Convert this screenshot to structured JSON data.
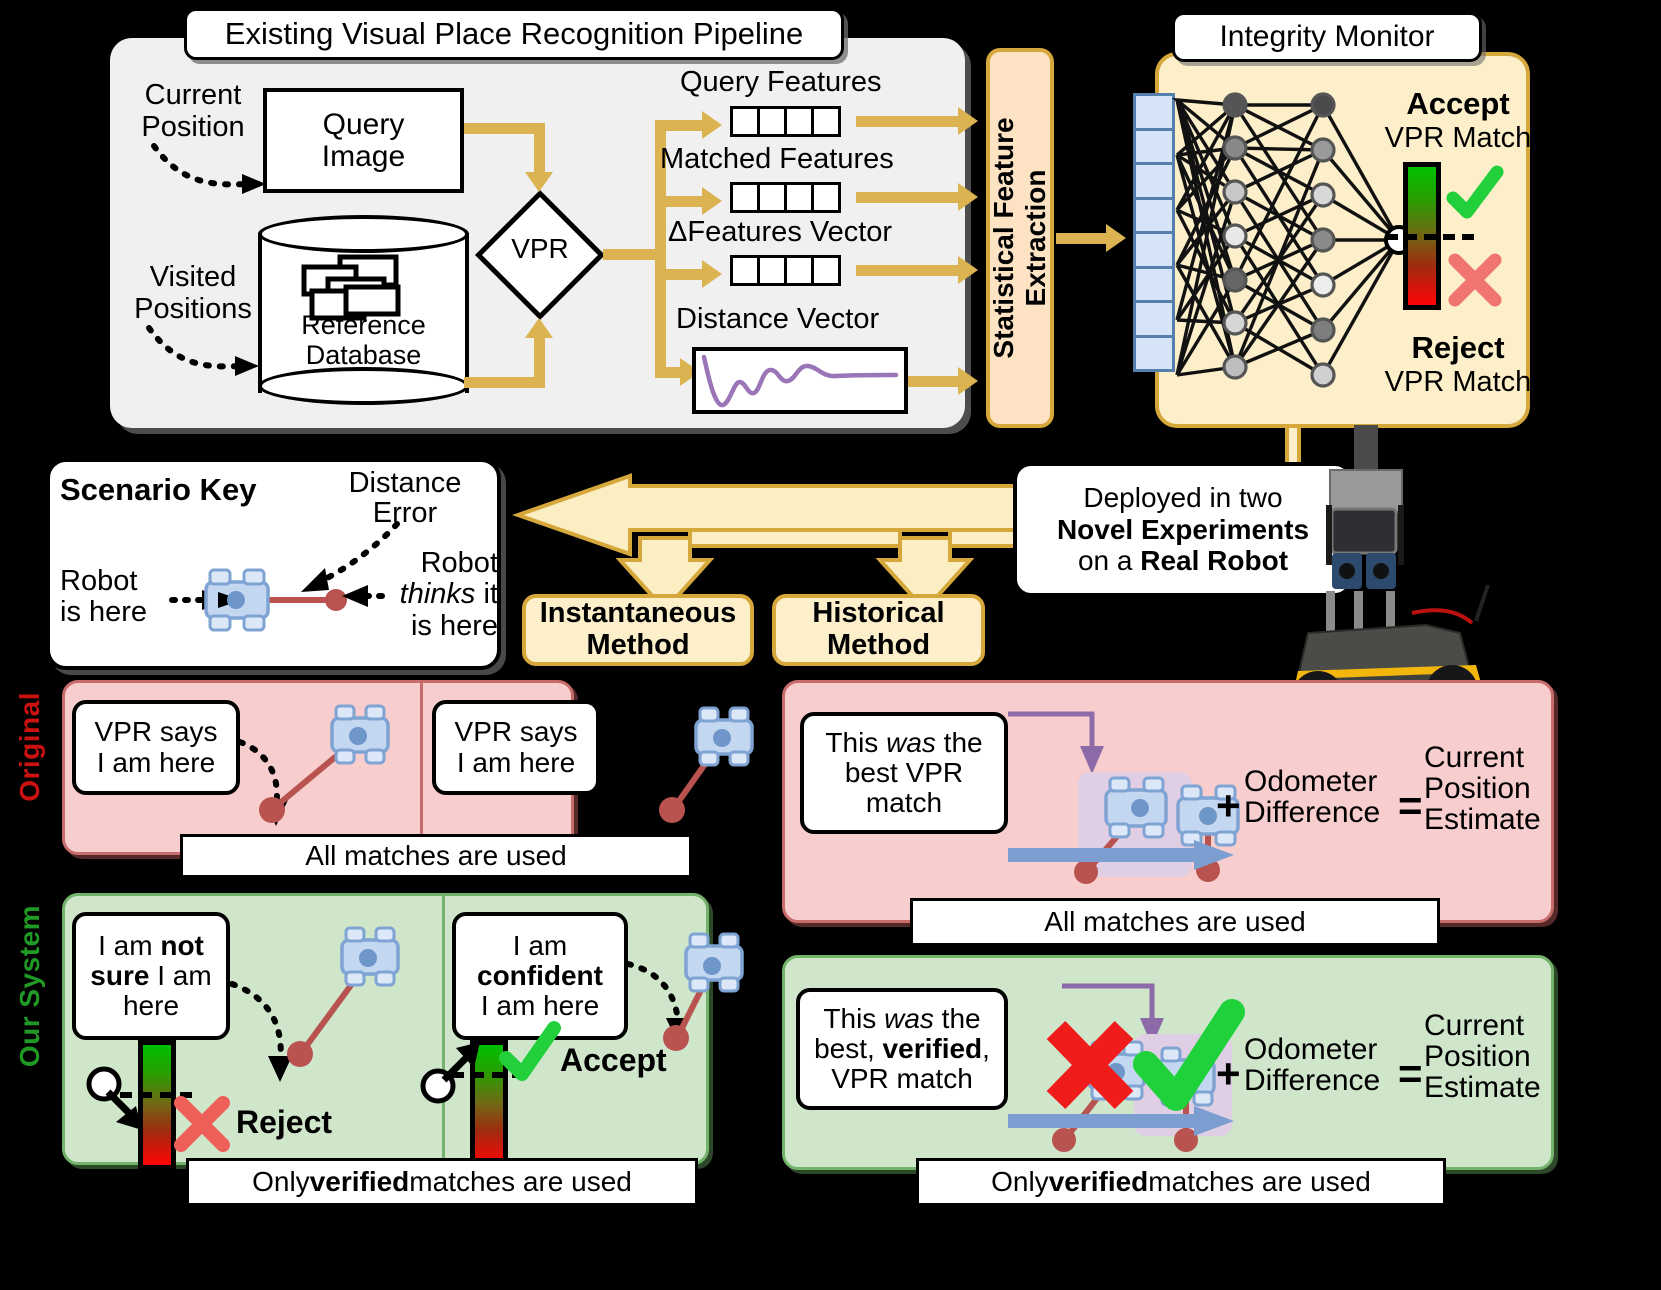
{
  "figure": {
    "background": "#000000",
    "accent_gold": "#dbb351",
    "panel_cream": "#fcefc9",
    "panel_peach": "#fde3c4",
    "panel_pink": "#f7cdcd",
    "panel_green": "#cfe6cb",
    "robot_blue": "#c3d8f0",
    "error_red": "#b8534f",
    "purple": "#8d6aa8"
  },
  "pipeline": {
    "title": "Existing Visual Place Recognition Pipeline",
    "current_position_label": "Current\nPosition",
    "current_position_line1": "Current",
    "current_position_line2": "Position",
    "visited_positions_line1": "Visited",
    "visited_positions_line2": "Positions",
    "query_image_line1": "Query",
    "query_image_line2": "Image",
    "reference_db_line1": "Reference",
    "reference_db_line2": "Database",
    "vpr_label": "VPR",
    "outputs": [
      {
        "label": "Query Features",
        "kind": "vector",
        "cells": 4
      },
      {
        "label": "Matched Features",
        "kind": "vector",
        "cells": 4
      },
      {
        "label": "ΔFeatures Vector",
        "kind": "vector",
        "cells": 4
      },
      {
        "label": "Distance Vector",
        "kind": "plot",
        "cells": 0
      }
    ]
  },
  "feature_extraction": {
    "line1": "Statistical Feature",
    "line2": "Extraction"
  },
  "integrity_monitor": {
    "title": "Integrity Monitor",
    "input_vector_cells": 8,
    "hidden_layer_1_nodes": 8,
    "hidden_layer_2_nodes": 8,
    "output_nodes": 1,
    "accept_label": "Accept",
    "accept_sub": "VPR Match",
    "reject_label": "Reject",
    "reject_sub": "VPR Match",
    "accept_icon": "check-icon",
    "reject_icon": "cross-icon"
  },
  "scenario_key": {
    "title": "Scenario Key",
    "distance_error_line1": "Distance",
    "distance_error_line2": "Error",
    "robot_is_here_line1": "Robot",
    "robot_is_here_line2": "is here",
    "robot_thinks_line1": "Robot",
    "robot_thinks_line2_italic": "thinks",
    "robot_thinks_line2_rest": " it",
    "robot_thinks_line3": "is here"
  },
  "methods": {
    "instantaneous_line1": "Instantaneous",
    "instantaneous_line2": "Method",
    "historical_line1": "Historical",
    "historical_line2": "Method"
  },
  "deployment": {
    "line1": "Deployed in two",
    "line2_bold": "Novel Experiments",
    "line3_prefix": "on a ",
    "line3_bold": "Real Robot"
  },
  "row_labels": {
    "original": "Original",
    "our_system": "Our System"
  },
  "instantaneous_original": {
    "left_speech_line1": "VPR says",
    "left_speech_line2": "I am here",
    "right_speech_line1": "VPR says",
    "right_speech_line2": "I am here",
    "caption": "All matches are used"
  },
  "instantaneous_ours": {
    "left_speech_l1_a": "I am ",
    "left_speech_l1_b": "not",
    "left_speech_l2_a": "sure",
    "left_speech_l2_b": " I am",
    "left_speech_l3": "here",
    "right_speech_l1": "I am",
    "right_speech_l2": "confident",
    "right_speech_l3": "I am here",
    "reject_label": "Reject",
    "accept_label": "Accept",
    "caption_prefix": "Only ",
    "caption_bold": "verified",
    "caption_suffix": " matches are used"
  },
  "historical_original": {
    "speech_line1_a": "This ",
    "speech_line1_italic": "was",
    "speech_line1_b": " the",
    "speech_line2": "best VPR",
    "speech_line3": "match",
    "odometer_line1": "Odometer",
    "odometer_line2": "Difference",
    "plus": "+",
    "equals": "=",
    "result_line1": "Current",
    "result_line2": "Position",
    "result_line3": "Estimate",
    "caption": "All matches are used"
  },
  "historical_ours": {
    "speech_line1_a": "This ",
    "speech_line1_italic": "was",
    "speech_line1_b": " the",
    "speech_line2_a": "best, ",
    "speech_line2_bold": "verified",
    "speech_line2_b": ",",
    "speech_line3": "VPR match",
    "odometer_line1": "Odometer",
    "odometer_line2": "Difference",
    "plus": "+",
    "equals": "=",
    "result_line1": "Current",
    "result_line2": "Position",
    "result_line3": "Estimate",
    "caption_prefix": "Only ",
    "caption_bold": "verified",
    "caption_suffix": " matches are used"
  }
}
